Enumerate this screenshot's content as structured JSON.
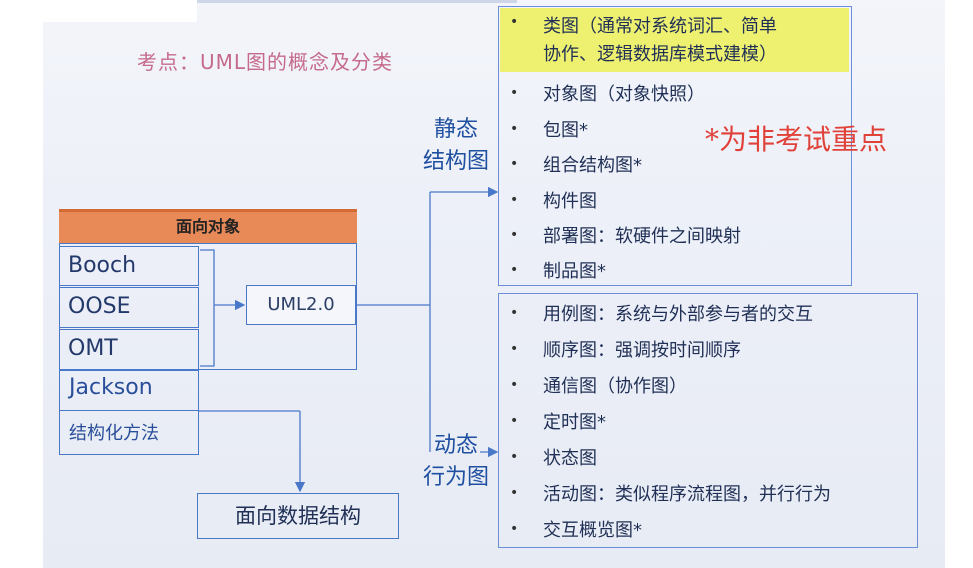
{
  "title": "考点：UML图的概念及分类",
  "left_panel": {
    "header": "面向对象",
    "methods_boxed": [
      "Booch",
      "OOSE",
      "OMT"
    ],
    "methods_plain": [
      "Jackson",
      "结构化方法"
    ],
    "uml_box": "UML2.0",
    "data_structure_box": "面向数据结构"
  },
  "static_group": {
    "label_line1": "静态",
    "label_line2": "结构图",
    "items": [
      "类图（通常对系统词汇、简单",
      "协作、逻辑数据库模式建模）",
      "对象图（对象快照）",
      "包图*",
      "组合结构图*",
      "构件图",
      "部署图：软硬件之间映射",
      "制品图*"
    ]
  },
  "dynamic_group": {
    "label_line1": "动态",
    "label_line2": "行为图",
    "items": [
      "用例图：系统与外部参与者的交互",
      "顺序图：强调按时间顺序",
      "通信图（协作图）",
      "定时图*",
      "状态图",
      "活动图：类似程序流程图，并行行为",
      "交互概览图*"
    ]
  },
  "note": "*为非考试重点",
  "colors": {
    "header_orange": "#e88a58",
    "highlight_yellow": "#eef070",
    "note_red": "#e0423a",
    "title_pink": "#c66a8b",
    "border_blue": "#4a78c8"
  }
}
